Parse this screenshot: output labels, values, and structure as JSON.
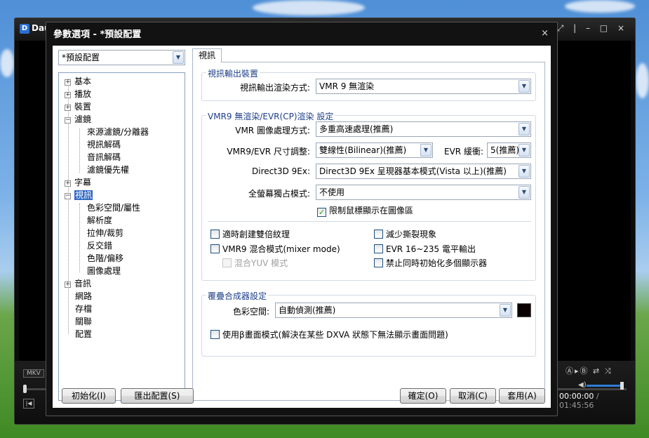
{
  "player": {
    "name": "Dau",
    "format_badge": "MKV",
    "time_current": "00:00:00",
    "time_separator": " / ",
    "time_total": "01:45:56"
  },
  "dialog": {
    "title": "參數選項 - *預設配置",
    "close_icon": "×",
    "profile": "*預設配置"
  },
  "tree": {
    "items": [
      {
        "label": "基本",
        "expander": "+"
      },
      {
        "label": "播放",
        "expander": "+"
      },
      {
        "label": "裝置",
        "expander": "+"
      },
      {
        "label": "濾鏡",
        "expander": "−"
      },
      {
        "label": "來源濾鏡/分離器"
      },
      {
        "label": "視訊解碼"
      },
      {
        "label": "音訊解碼"
      },
      {
        "label": "濾鏡優先權"
      },
      {
        "label": "字幕",
        "expander": "+"
      },
      {
        "label": "視訊",
        "expander": "−",
        "selected": true
      },
      {
        "label": "色彩空間/屬性"
      },
      {
        "label": "解析度"
      },
      {
        "label": "拉伸/裁剪"
      },
      {
        "label": "反交錯"
      },
      {
        "label": "色階/偏移"
      },
      {
        "label": "圖像處理"
      },
      {
        "label": "音訊",
        "expander": "+"
      },
      {
        "label": "網路"
      },
      {
        "label": "存檔"
      },
      {
        "label": "關聯"
      },
      {
        "label": "配置"
      }
    ]
  },
  "tab": {
    "label": "視訊"
  },
  "output_group": {
    "title": "視訊輸出裝置",
    "renderer_label": "視訊輸出渲染方式:",
    "renderer_value": "VMR 9 無渲染"
  },
  "vmr_group": {
    "title": "VMR9 無渲染/EVR(CP)渲染 設定",
    "processing_label": "VMR 圖像處理方式:",
    "processing_value": "多重高速處理(推薦)",
    "resize_label": "VMR9/EVR 尺寸調整:",
    "resize_value": "雙線性(Bilinear)(推薦)",
    "evr_buffer_label": "EVR 緩衝:",
    "evr_buffer_value": "5(推薦)",
    "d3d_label": "Direct3D 9Ex:",
    "d3d_value": "Direct3D 9Ex 呈現器基本模式(Vista 以上)(推薦)",
    "fullscreen_label": "全螢幕獨占模式:",
    "fullscreen_value": "不使用",
    "limit_mouse": "限制鼠標顯示在圖像區",
    "double_texture": "適時創建雙倍紋理",
    "reduce_tearing": "減少撕裂現象",
    "mixer_mode": "VMR9 混合模式(mixer mode)",
    "evr_range": "EVR 16~235 電平輸出",
    "mix_yuv": "混合YUV 模式",
    "no_multi_display": "禁止同時初始化多個顯示器"
  },
  "overlay_group": {
    "title": "覆疊合成器設定",
    "colorspace_label": "色彩空間:",
    "colorspace_value": "自動偵測(推薦)",
    "swatch_color": "#0a0000",
    "beta_mode": "使用β畫面模式(解決在某些 DXVA 狀態下無法顯示畫面問題)"
  },
  "buttons": {
    "init": "初始化(I)",
    "export": "匯出配置(S)",
    "ok": "確定(O)",
    "cancel": "取消(C)",
    "apply": "套用(A)"
  },
  "glyphs": {
    "combo_arrow": "▼",
    "check": "✓"
  }
}
